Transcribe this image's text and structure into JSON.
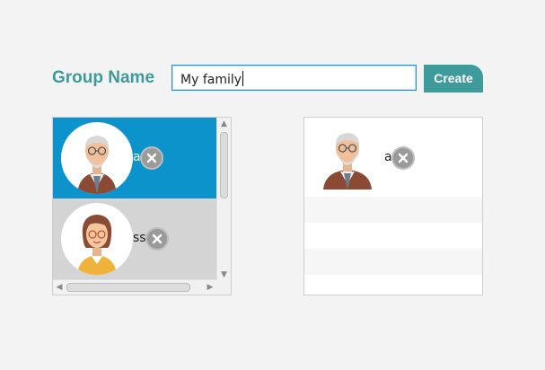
{
  "form": {
    "group_name_label": "Group Name",
    "group_name_value": "My family",
    "create_label": "Create"
  },
  "available_members": [
    {
      "name_fragment": "a",
      "avatar": "grandfather-avatar",
      "selected": true
    },
    {
      "name_fragment": "ss",
      "avatar": "grandmother-avatar",
      "selected": false
    }
  ],
  "group_members": [
    {
      "name_fragment": "a",
      "avatar": "grandfather-avatar"
    }
  ],
  "colors": {
    "accent": "#3e9a9b",
    "selection": "#0c93cc",
    "input_border": "#1e8fd0"
  },
  "icons": {
    "remove": "close-x-icon",
    "scroll_up": "chevron-up-icon",
    "scroll_down": "chevron-down-icon",
    "scroll_left": "chevron-left-icon",
    "scroll_right": "chevron-right-icon"
  }
}
